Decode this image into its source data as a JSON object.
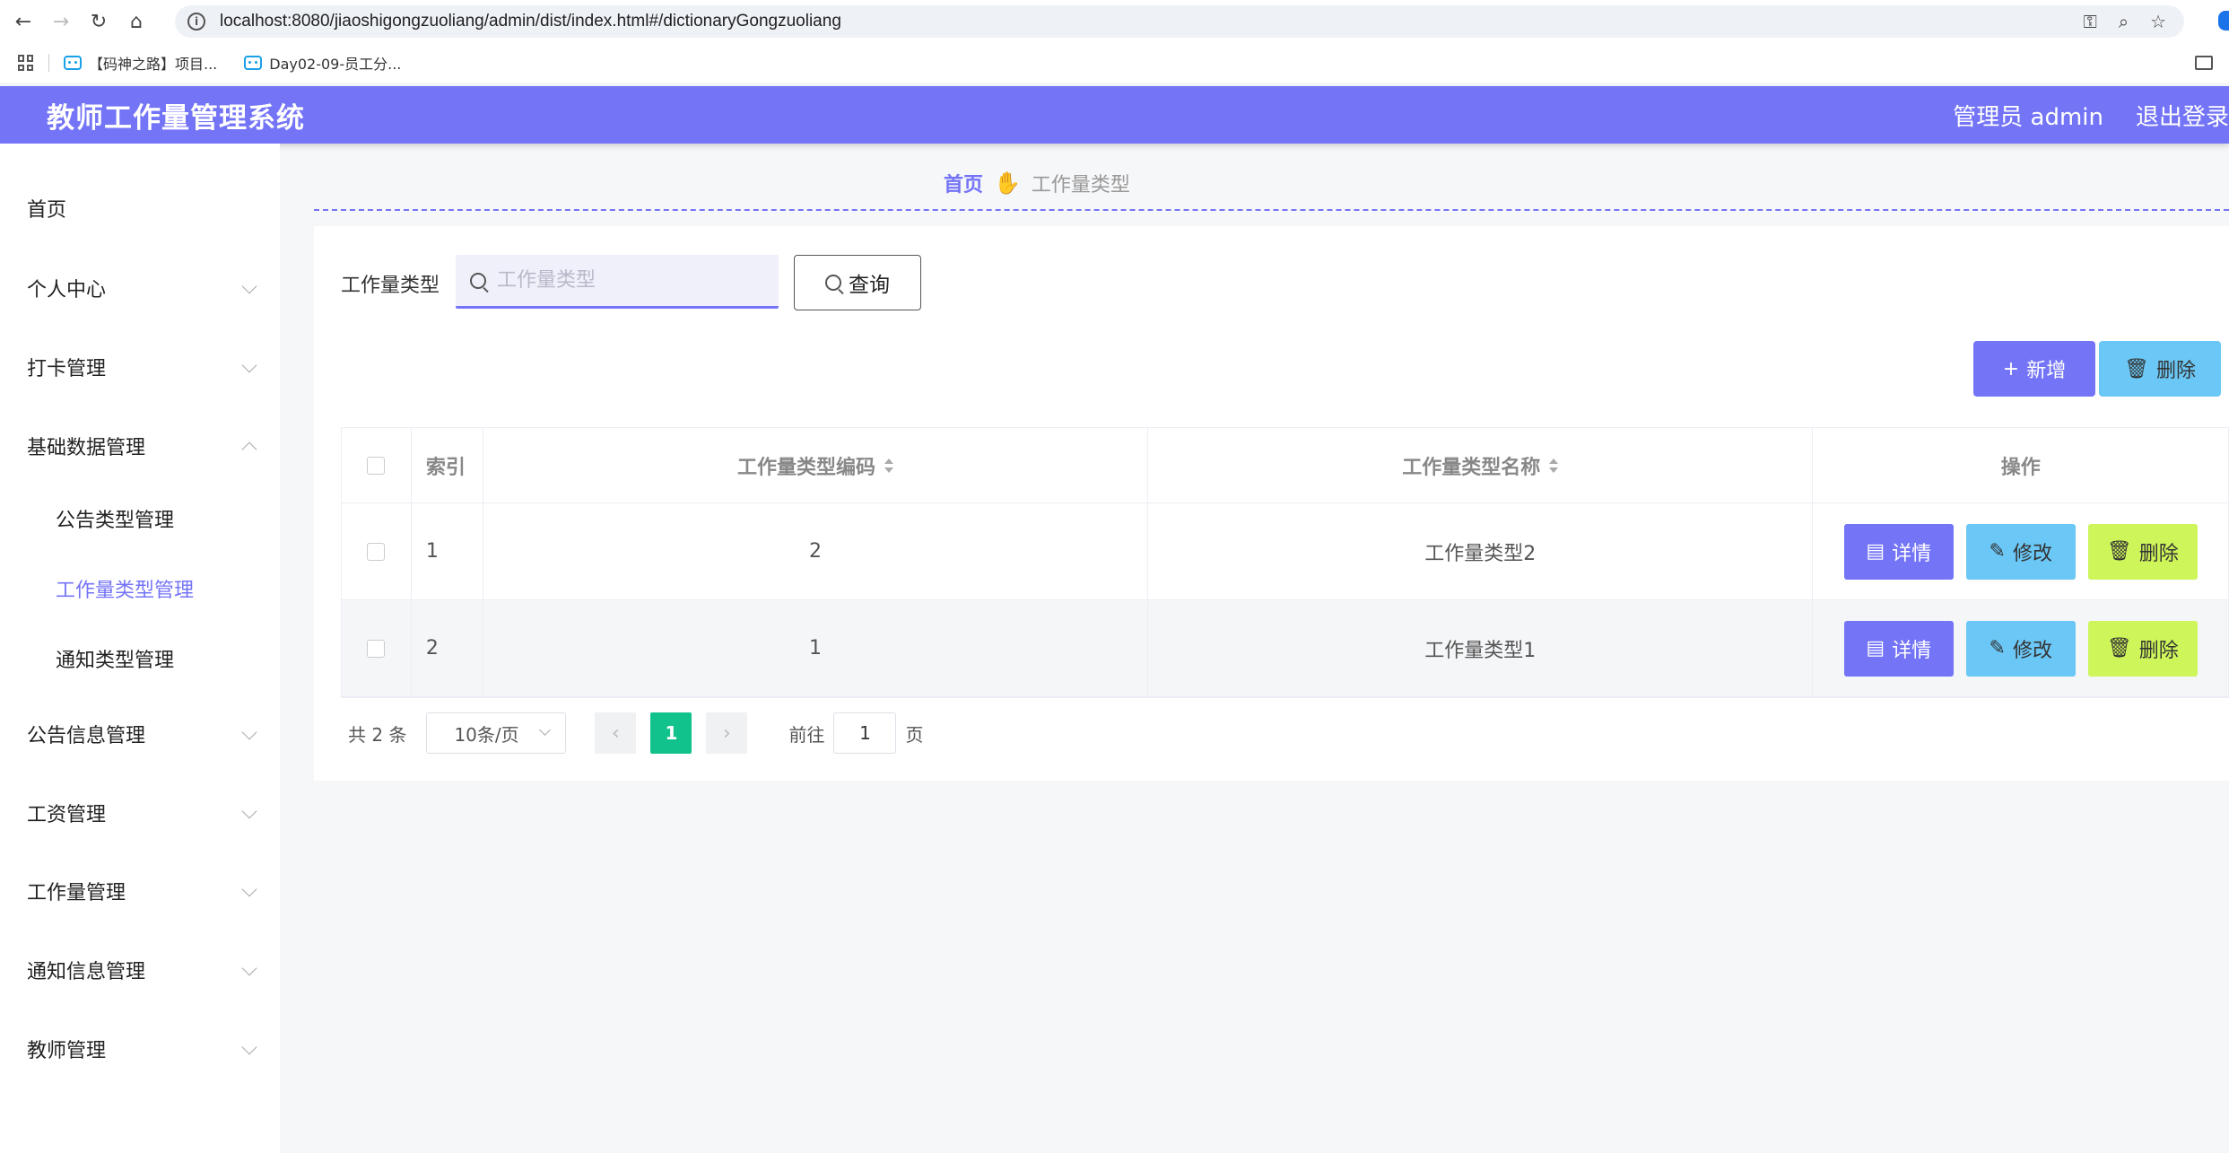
{
  "browser": {
    "url": "localhost:8080/jiaoshigongzuoliang/admin/dist/index.html#/dictionaryGongzuoliang",
    "bookmarks": [
      "【码神之路】项目...",
      "Day02-09-员工分..."
    ]
  },
  "header": {
    "title": "教师工作量管理系统",
    "user": "管理员 admin",
    "logout": "退出登录",
    "color": "#7474f7"
  },
  "sidebar": {
    "items": [
      {
        "label": "首页"
      },
      {
        "label": "个人中心"
      },
      {
        "label": "打卡管理"
      },
      {
        "label": "基础数据管理"
      },
      {
        "label": "公告信息管理"
      },
      {
        "label": "工资管理"
      },
      {
        "label": "工作量管理"
      },
      {
        "label": "通知信息管理"
      },
      {
        "label": "教师管理"
      }
    ],
    "sub_items": [
      {
        "label": "公告类型管理"
      },
      {
        "label": "工作量类型管理"
      },
      {
        "label": "通知类型管理"
      }
    ]
  },
  "breadcrumb": {
    "home": "首页",
    "current": "工作量类型"
  },
  "search": {
    "label": "工作量类型",
    "placeholder": "工作量类型",
    "query_label": "查询"
  },
  "actions": {
    "add_label": "新增",
    "delete_label": "删除"
  },
  "table": {
    "headers": {
      "index": "索引",
      "code": "工作量类型编码",
      "name": "工作量类型名称",
      "ops": "操作"
    },
    "rows": [
      {
        "index": "1",
        "code": "2",
        "name": "工作量类型2"
      },
      {
        "index": "2",
        "code": "1",
        "name": "工作量类型1"
      }
    ],
    "op_labels": {
      "detail": "详情",
      "edit": "修改",
      "delete": "删除"
    }
  },
  "pagination": {
    "total": "共 2 条",
    "page_size": "10条/页",
    "current_page": "1",
    "goto_prefix": "前往",
    "goto_value": "1",
    "goto_suffix": "页"
  }
}
